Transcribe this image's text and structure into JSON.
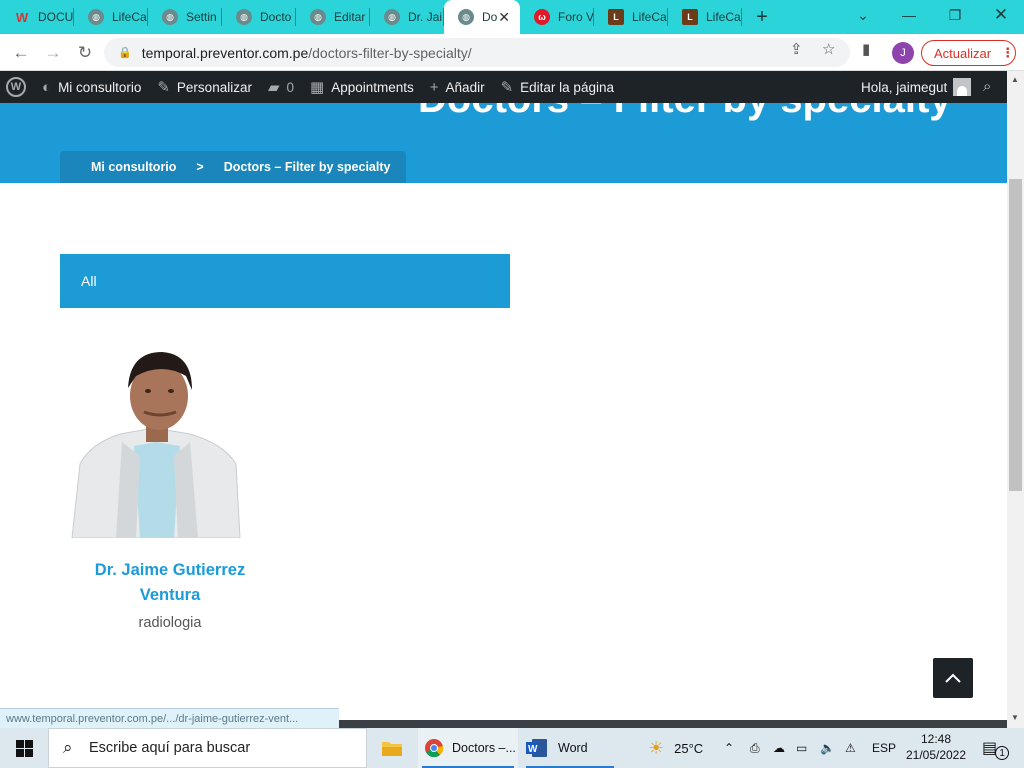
{
  "browser": {
    "tabs": [
      {
        "label": "DOCU",
        "icon": "docs-logo-icon"
      },
      {
        "label": "LifeCa",
        "icon": "globe-icon"
      },
      {
        "label": "Settin",
        "icon": "globe-icon"
      },
      {
        "label": "Docto",
        "icon": "globe-icon"
      },
      {
        "label": "Editar",
        "icon": "globe-icon"
      },
      {
        "label": "Dr. Jai",
        "icon": "globe-icon"
      },
      {
        "label": "Do",
        "icon": "globe-icon",
        "active": true
      },
      {
        "label": "Foro V",
        "icon": "foro-logo-icon"
      },
      {
        "label": "LifeCa",
        "icon": "lifecare-logo-icon"
      },
      {
        "label": "LifeCa",
        "icon": "lifecare-logo-icon"
      }
    ],
    "url_host": "temporal.preventor.com.pe",
    "url_path": "/doctors-filter-by-specialty/",
    "profile_initial": "J",
    "update_label": "Actualizar",
    "status_link": "www.temporal.preventor.com.pe/.../dr-jaime-gutierrez-vent..."
  },
  "adminbar": {
    "site_name": "Mi consultorio",
    "customize": "Personalizar",
    "comments_count": "0",
    "appointments": "Appointments",
    "add_new": "Añadir",
    "edit_page": "Editar la página",
    "greeting": "Hola, jaimegut"
  },
  "page": {
    "title": "Doctors – Filter by specialty",
    "breadcrumb_home": "Mi consultorio",
    "breadcrumb_sep": ">",
    "breadcrumb_current": "Doctors – Filter by specialty",
    "filter_label": "All",
    "doctor": {
      "name_line1": "Dr. Jaime Gutierrez",
      "name_line2": "Ventura",
      "specialty": "radiologia"
    }
  },
  "taskbar": {
    "search_placeholder": "Escribe aquí para buscar",
    "chrome_label": "Doctors –...",
    "word_label": "Word",
    "temperature": "25°C",
    "language": "ESP",
    "time": "12:48",
    "date": "21/05/2022",
    "notification_count": "1"
  },
  "colors": {
    "accent": "#1d9bd7",
    "tabstrip": "#2bd4d8",
    "adminbar": "#1d2327"
  }
}
